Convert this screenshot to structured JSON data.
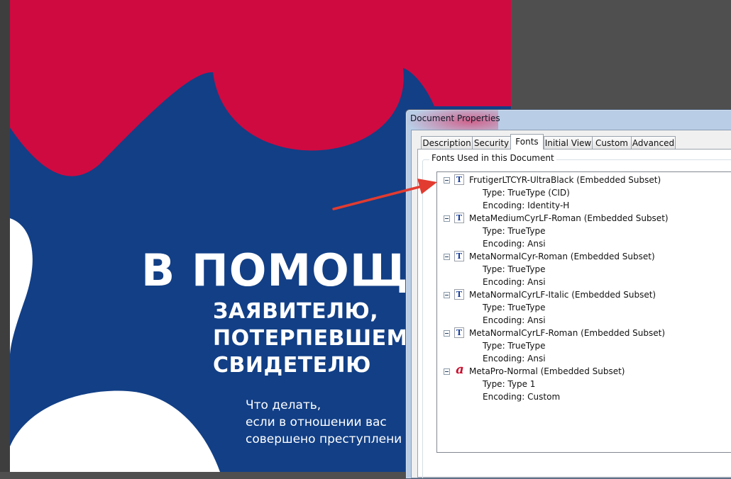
{
  "pdf_page": {
    "title": "В ПОМОЩ",
    "subtitle": [
      "ЗАЯВИТЕЛЮ,",
      "ПОТЕРПЕВШЕМ",
      "СВИДЕТЕЛЮ"
    ],
    "body": [
      "Что делать,",
      "если в отношении вас",
      "совершено преступлени"
    ],
    "colors": {
      "background": "#123f86",
      "accent": "#cf0a41",
      "text": "#ffffff"
    }
  },
  "dialog": {
    "title": "Document Properties",
    "tabs": [
      {
        "label": "Description",
        "active": false
      },
      {
        "label": "Security",
        "active": false
      },
      {
        "label": "Fonts",
        "active": true
      },
      {
        "label": "Initial View",
        "active": false
      },
      {
        "label": "Custom",
        "active": false
      },
      {
        "label": "Advanced",
        "active": false
      }
    ],
    "group_label": "Fonts Used in this Document",
    "fonts": [
      {
        "name": "FrutigerLTCYR-UltraBlack (Embedded Subset)",
        "type": "Type: TrueType (CID)",
        "encoding": "Encoding: Identity-H",
        "icon": "truetype-font-icon"
      },
      {
        "name": "MetaMediumCyrLF-Roman (Embedded Subset)",
        "type": "Type: TrueType",
        "encoding": "Encoding: Ansi",
        "icon": "truetype-font-icon"
      },
      {
        "name": "MetaNormalCyr-Roman (Embedded Subset)",
        "type": "Type: TrueType",
        "encoding": "Encoding: Ansi",
        "icon": "truetype-font-icon"
      },
      {
        "name": "MetaNormalCyrLF-Italic (Embedded Subset)",
        "type": "Type: TrueType",
        "encoding": "Encoding: Ansi",
        "icon": "truetype-font-icon"
      },
      {
        "name": "MetaNormalCyrLF-Roman (Embedded Subset)",
        "type": "Type: TrueType",
        "encoding": "Encoding: Ansi",
        "icon": "truetype-font-icon"
      },
      {
        "name": "MetaPro-Normal (Embedded Subset)",
        "type": "Type: Type 1",
        "encoding": "Encoding: Custom",
        "icon": "type1-font-icon"
      }
    ]
  },
  "annotation": {
    "color": "#e23b30"
  }
}
